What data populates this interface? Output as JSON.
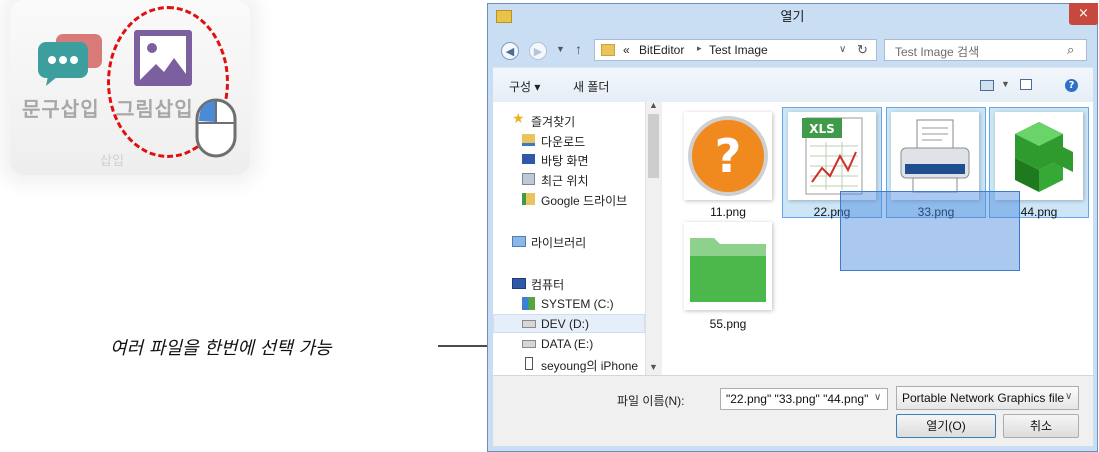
{
  "toolbar_fragment": {
    "labels": [
      "문구삽입",
      "그림삽입"
    ],
    "group_label": "삽입"
  },
  "annotation": {
    "callout_text": "여러 파일을 한번에 선택 가능"
  },
  "dialog": {
    "title": "열기",
    "close_glyph": "×",
    "address": {
      "prefix": "«",
      "crumbs": [
        "BitEditor",
        "Test Image"
      ],
      "separator": "▸"
    },
    "search_placeholder": "Test Image 검색",
    "commands": {
      "organize": "구성 ▾",
      "new_folder": "새 폴더"
    },
    "nav_tree": {
      "favorites": "즐겨찾기",
      "favorites_items": [
        "다운로드",
        "바탕 화면",
        "최근 위치",
        "Google 드라이브"
      ],
      "libraries": "라이브러리",
      "computer": "컴퓨터",
      "drives": [
        "SYSTEM (C:)",
        "DEV (D:)",
        "DATA (E:)",
        "seyoung의 iPhone"
      ]
    },
    "files": [
      {
        "name": "11.png",
        "selected": false
      },
      {
        "name": "22.png",
        "selected": true
      },
      {
        "name": "33.png",
        "selected": true
      },
      {
        "name": "44.png",
        "selected": true
      },
      {
        "name": "55.png",
        "selected": false
      }
    ],
    "thumb_badge_xls": "XLS",
    "filename_label": "파일 이름(N):",
    "filename_value": "\"22.png\" \"33.png\" \"44.png\"",
    "filetype_value": "Portable Network Graphics file",
    "open_label": "열기(O)",
    "cancel_label": "취소"
  },
  "colors": {
    "accent_red": "#e01010",
    "selection_blue": "#cce6f7",
    "drag_blue": "#4488dd",
    "close_red": "#c7493d"
  }
}
